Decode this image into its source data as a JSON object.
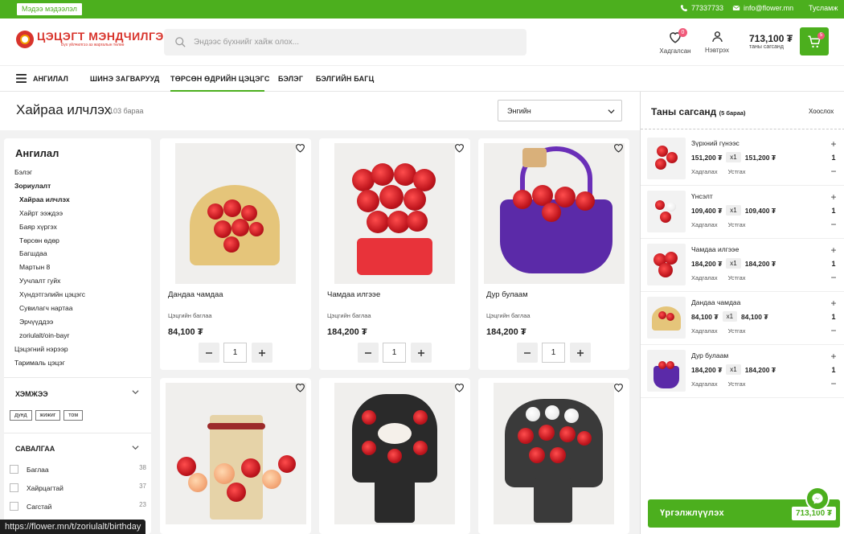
{
  "topbar": {
    "info_label": "Мэдээ мэдээлэл",
    "phone": "77337733",
    "email": "info@flower.mn",
    "help": "Тусламж"
  },
  "header": {
    "logo_name": "ЦЭЦЭГТ МЭНДЧИЛГЭЭ",
    "logo_tagline": "Бүх үйлчилгээ аз жаргалын төлөө",
    "search_placeholder": "Эндээс бүхнийг хайж олох...",
    "favorites_label": "Хадгалсан",
    "favorites_count": "0",
    "login_label": "Нэвтрэх",
    "cart_total": "713,100 ₮",
    "cart_total_label": "таны сагсанд",
    "cart_count": "5"
  },
  "nav": {
    "category_label": "АНГИЛАЛ",
    "items": [
      "ШИНЭ ЗАГВАРУУД",
      "ТӨРСӨН ӨДРИЙН ЦЭЦЭГС",
      "БЭЛЭГ",
      "БЭЛГИЙН БАГЦ"
    ]
  },
  "page": {
    "title": "Хайраа илчлэх",
    "count": "103 бараа",
    "sort_value": "Энгийн"
  },
  "sidebar": {
    "heading": "Ангилал",
    "categories": [
      {
        "label": "Бэлэг",
        "level": 0,
        "bold": false
      },
      {
        "label": "Зориулалт",
        "level": 0,
        "bold": true
      },
      {
        "label": "Хайраа илчлэх",
        "level": 1,
        "bold": true
      },
      {
        "label": "Хайрт ээждээ",
        "level": 1,
        "bold": false
      },
      {
        "label": "Баяр хүргэх",
        "level": 1,
        "bold": false
      },
      {
        "label": "Төрсөн өдөр",
        "level": 1,
        "bold": false
      },
      {
        "label": "Багшдаа",
        "level": 1,
        "bold": false
      },
      {
        "label": "Мартын 8",
        "level": 1,
        "bold": false
      },
      {
        "label": "Уучлалт гуйх",
        "level": 1,
        "bold": false
      },
      {
        "label": "Хүндэтгэлийн цэцэгс",
        "level": 1,
        "bold": false
      },
      {
        "label": "Сувилагч нартаа",
        "level": 1,
        "bold": false
      },
      {
        "label": "Эрчүүддээ",
        "level": 1,
        "bold": false
      },
      {
        "label": "zoriulalt/oin-bayr",
        "level": 1,
        "bold": false
      },
      {
        "label": "Цэцэгний нэрээр",
        "level": 0,
        "bold": false
      },
      {
        "label": "Тарималь цэцэг",
        "level": 0,
        "bold": false
      }
    ],
    "size_title": "ХЭМЖЭЭ",
    "sizes": [
      "дунд",
      "жижиг",
      "том"
    ],
    "wrap_title": "САВАЛГАА",
    "wraps": [
      {
        "label": "Баглаа",
        "count": "38"
      },
      {
        "label": "Хайрцагтай",
        "count": "37"
      },
      {
        "label": "Сагстай",
        "count": "23"
      }
    ]
  },
  "products": [
    {
      "name": "Дандаа чамдаа",
      "category": "Цэцгийн баглаа",
      "price": "84,100 ₮",
      "qty": "1"
    },
    {
      "name": "Чамдаа илгээе",
      "category": "Цэцгийн баглаа",
      "price": "184,200 ₮",
      "qty": "1"
    },
    {
      "name": "Дур булаам",
      "category": "Цэцгийн баглаа",
      "price": "184,200 ₮",
      "qty": "1"
    }
  ],
  "cart": {
    "title": "Таны сагсанд",
    "count_label": "(5 бараа)",
    "clear_label": "Хоослох",
    "save_label": "Хадгалах",
    "remove_label": "Устгах",
    "items": [
      {
        "name": "Зүрхний гүнээс",
        "price": "151,200 ₮",
        "qty_label": "x1",
        "total": "151,200 ₮",
        "qty": "1"
      },
      {
        "name": "Үнсэлт",
        "price": "109,400 ₮",
        "qty_label": "x1",
        "total": "109,400 ₮",
        "qty": "1"
      },
      {
        "name": "Чамдаа илгээе",
        "price": "184,200 ₮",
        "qty_label": "x1",
        "total": "184,200 ₮",
        "qty": "1"
      },
      {
        "name": "Дандаа чамдаа",
        "price": "84,100 ₮",
        "qty_label": "x1",
        "total": "84,100 ₮",
        "qty": "1"
      },
      {
        "name": "Дур булаам",
        "price": "184,200 ₮",
        "qty_label": "x1",
        "total": "184,200 ₮",
        "qty": "1"
      }
    ],
    "checkout_label": "Үргэлжлүүлэх",
    "checkout_total": "713,100 ₮"
  },
  "status_url": "https://flower.mn/t/zoriulalt/birthday",
  "colors": {
    "accent": "#4caf1e",
    "badge": "#f05a7a",
    "logo": "#d8342c"
  }
}
